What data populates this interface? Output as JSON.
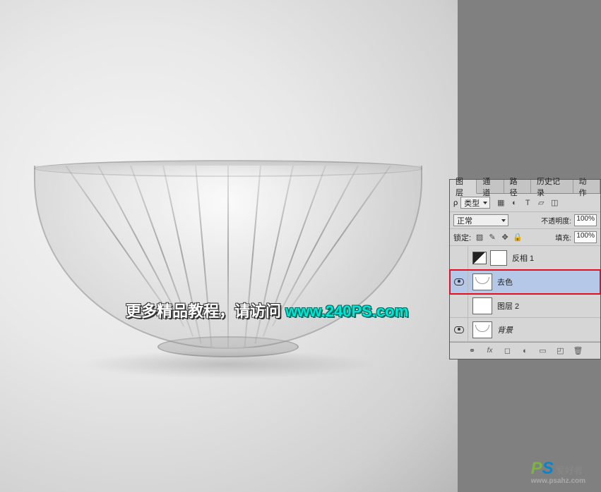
{
  "panel": {
    "tabs": [
      "图层",
      "通道",
      "路径",
      "历史记录",
      "动作"
    ],
    "active_tab": 0,
    "filter": {
      "type_label": "类型",
      "icons": [
        "image-filter-icon",
        "adjustment-filter-icon",
        "text-filter-icon",
        "shape-filter-icon",
        "smart-filter-icon"
      ]
    },
    "blend_mode": "正常",
    "opacity_label": "不透明度:",
    "opacity_value": "100%",
    "lock_label": "锁定:",
    "fill_label": "填充:",
    "fill_value": "100%",
    "layers": [
      {
        "name": "反相 1",
        "visible": false,
        "type": "adjustment",
        "has_mask": true
      },
      {
        "name": "去色",
        "visible": true,
        "type": "image",
        "selected": true,
        "highlighted": true
      },
      {
        "name": "图层 2",
        "visible": false,
        "type": "image"
      },
      {
        "name": "背景",
        "visible": true,
        "type": "background",
        "italic": true
      }
    ],
    "footer_icons": [
      "link-icon",
      "fx-icon",
      "mask-icon",
      "adjustment-icon",
      "group-icon",
      "new-layer-icon",
      "trash-icon"
    ]
  },
  "watermark": {
    "text_prefix": "更多精品教程，请访问 ",
    "url": "www.240PS.com",
    "logo_p": "P",
    "logo_s": "S",
    "logo_sub": "爱好者",
    "logo_site": "www.psahz.com"
  }
}
